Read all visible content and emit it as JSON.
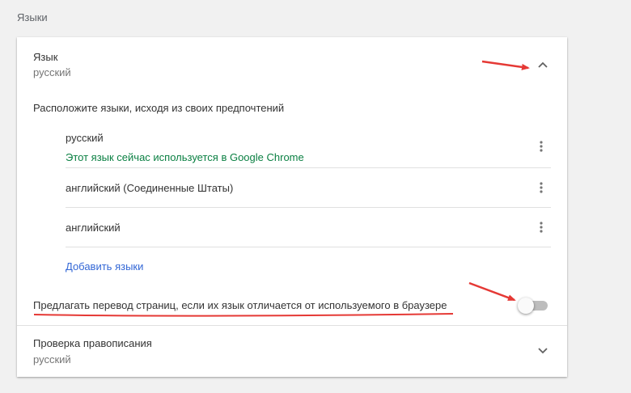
{
  "section": {
    "title": "Языки"
  },
  "language": {
    "title": "Язык",
    "subtitle": "русский",
    "order_label": "Расположите языки, исходя из своих предпочтений",
    "items": [
      {
        "name": "русский",
        "note": "Этот язык сейчас используется в Google Chrome"
      },
      {
        "name": "английский (Соединенные Штаты)"
      },
      {
        "name": "английский"
      }
    ],
    "add_link": "Добавить языки",
    "offer_translate_label": "Предлагать перевод страниц, если их язык отличается от используемого в браузере",
    "offer_translate_enabled": false
  },
  "spellcheck": {
    "title": "Проверка правописания",
    "subtitle": "русский"
  },
  "colors": {
    "annotation": "#e53935",
    "link": "#3367d6",
    "note": "#0b8043"
  }
}
